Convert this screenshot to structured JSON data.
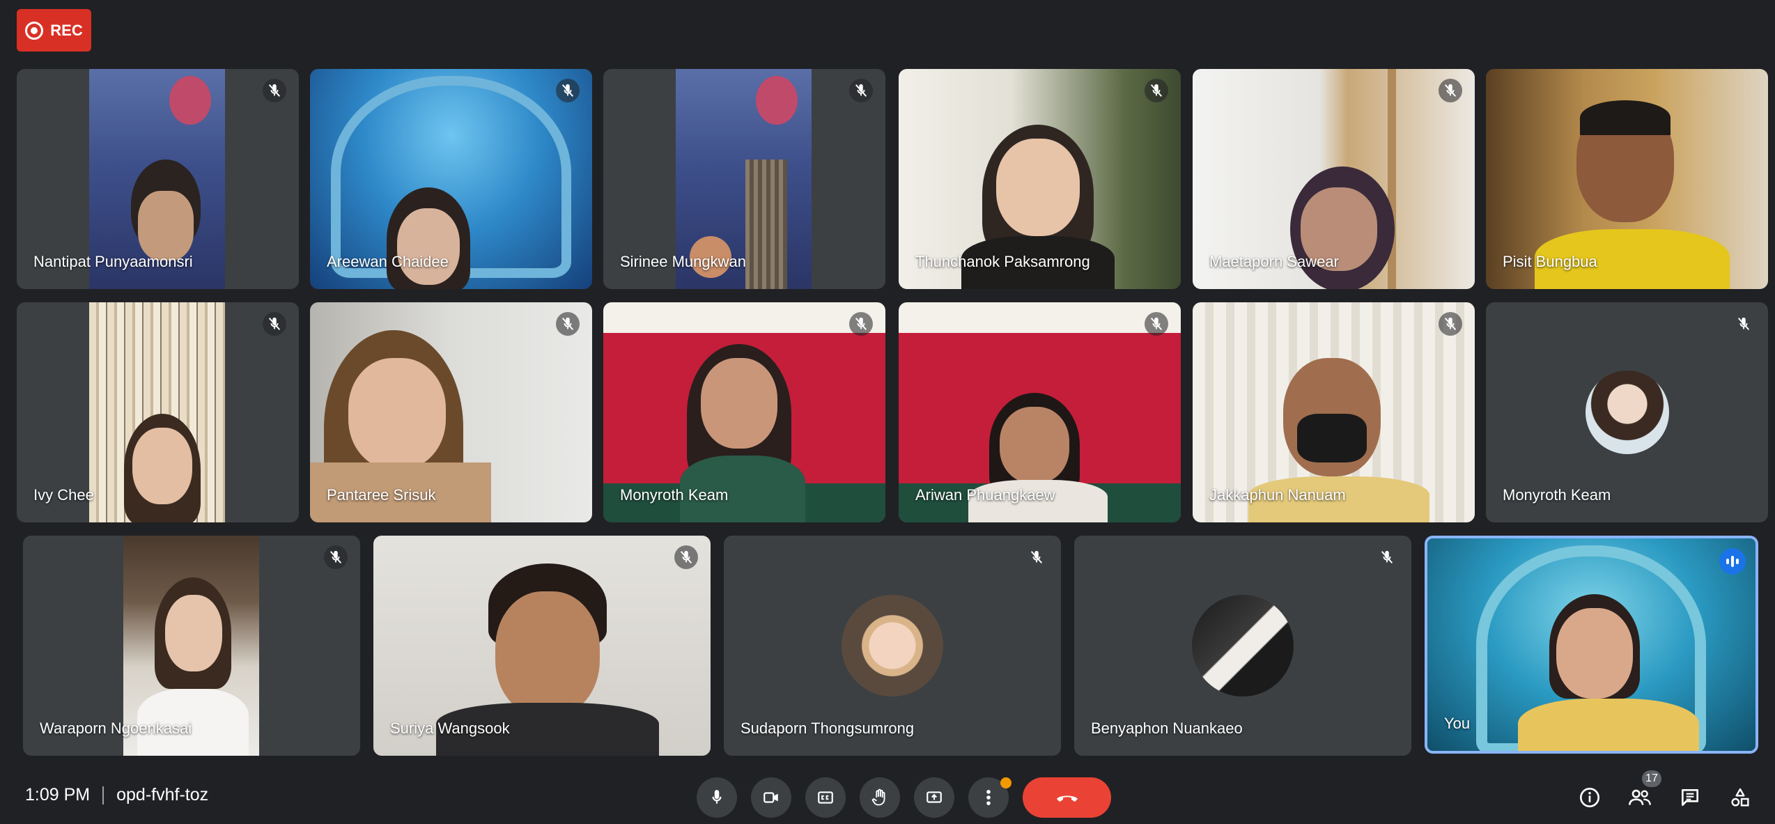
{
  "recording": {
    "label": "REC"
  },
  "participants": [
    {
      "name": "Nantipat Punyaamonsri"
    },
    {
      "name": "Areewan Chaidee"
    },
    {
      "name": "Sirinee Mungkwan"
    },
    {
      "name": "Thunchanok Paksamrong"
    },
    {
      "name": "Maetaporn Sawear"
    },
    {
      "name": "Pisit Bungbua"
    },
    {
      "name": "Ivy Chee"
    },
    {
      "name": "Pantaree Srisuk"
    },
    {
      "name": "Monyroth Keam"
    },
    {
      "name": "Ariwan Phuangkaew"
    },
    {
      "name": "Jakkaphun Nanuam"
    },
    {
      "name": "Monyroth Keam"
    },
    {
      "name": "Waraporn Ngoenkasai"
    },
    {
      "name": "Suriya Wangsook"
    },
    {
      "name": "Sudaporn Thongsumrong"
    },
    {
      "name": "Benyaphon Nuankaeo"
    },
    {
      "name": "You"
    }
  ],
  "meeting": {
    "time": "1:09 PM",
    "code": "opd-fvhf-toz"
  },
  "people_count": "17",
  "icons": [
    "record-icon",
    "mic-off-icon",
    "mic-icon",
    "camera-icon",
    "captions-icon",
    "raise-hand-icon",
    "present-icon",
    "more-options-icon",
    "end-call-icon",
    "info-icon",
    "people-icon",
    "chat-icon",
    "activities-icon",
    "speaking-indicator-icon"
  ],
  "colors": {
    "background": "#202124",
    "tile": "#3c4043",
    "rec": "#d93025",
    "end_call": "#ea4335",
    "active_speaker": "#8ab4f8"
  }
}
